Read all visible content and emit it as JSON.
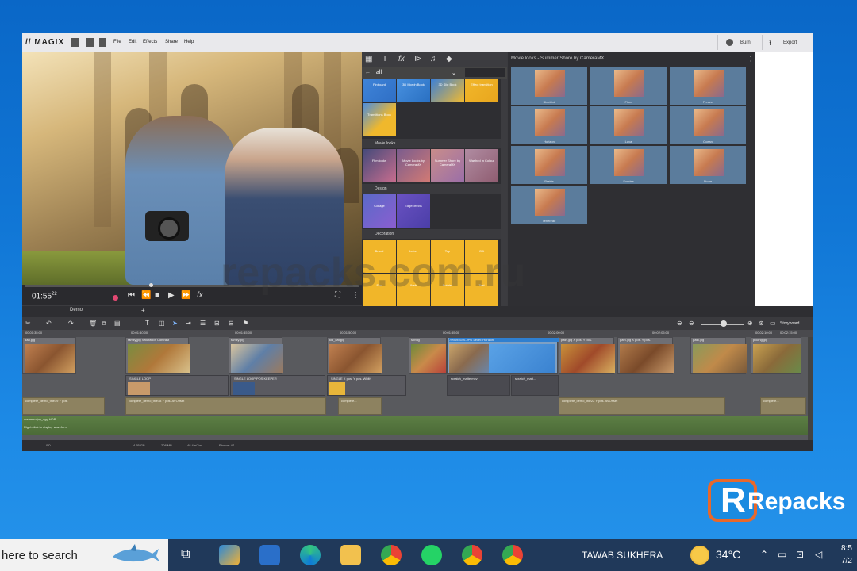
{
  "app": {
    "logo": "// MAGIX",
    "menu": [
      "File",
      "Edit",
      "Effects",
      "Share",
      "Help"
    ],
    "burn_label": "Burn",
    "export_label": "Export"
  },
  "preview": {
    "timecode": "01:55",
    "timecode_frames": "22",
    "fx_label": "fx"
  },
  "media_pool": {
    "filter_value": "all",
    "top_tiles": [
      "Pinboard",
      "3D Morph Book",
      "3D Slip Book",
      "Effect transition"
    ],
    "extra_tiles": [
      "Transitions Book"
    ],
    "sections": [
      {
        "name": "Movie looks",
        "tiles": [
          "Film looks",
          "Movie Looks by CameraMX",
          "Summer Shore by CameraMX",
          "Washed in Colour"
        ]
      },
      {
        "name": "Design",
        "tiles": [
          "Collage",
          "EdgeEffects"
        ]
      },
      {
        "name": "Decoration",
        "tiles": [
          "Brand",
          "Label",
          "Top",
          "Gift",
          "Fun",
          "Web",
          "Pointer",
          "Text"
        ]
      }
    ]
  },
  "looks_panel": {
    "title": "Movie looks - Summer Shore by CameraMX",
    "items": [
      "Bluebird",
      "Flora",
      "Freeze",
      "Horizon",
      "Lava",
      "Ocean",
      "Prairie",
      "Sunrise",
      "Stone",
      "Tenebrae"
    ]
  },
  "timeline": {
    "project_tab": "Demo",
    "storyboard_label": "Storyboard",
    "ruler": [
      "00:01:35:00",
      "00:01:40:00",
      "00:01:45:00",
      "00:01:50:00",
      "00:01:55:00",
      "00:02:00:00",
      "00:02:05:00",
      "00:02:10:00",
      "00:02:15:00"
    ],
    "video_clips": [
      "dad.jpg",
      "family.jpg  Saturation  Contrast",
      "family.jpg",
      "kid_cat.jpg",
      "spring",
      "70949464S.JPG  Level: Horizon",
      "path.jpg  X pos.  Y pos.",
      "path.jpg  X pos.  Y pos.",
      "path.jpg",
      "pocing.jpg"
    ],
    "overlay_clips": [
      "SINGLE LOOP",
      "SINGLE LOOP POS KEEPER",
      "SINGLE  X pos.  Y pos.  Width",
      "scratch_matte.mxv",
      "scratch_matt..."
    ],
    "title_clips": [
      "complete_demo_title19  Y pos.",
      "complete_demo_title18  Y pos.  AVOffset",
      "complete...",
      "complete_demo_title22  Y pos.  AVOffset",
      "complete..."
    ],
    "audio_clips": [
      "dreamsofjoy_ogg.HDP",
      "Right-click to display waveform"
    ],
    "status": [
      "0/0",
      "4.55 GB",
      "208 MB",
      "48.4m/7m",
      "Photos: 47"
    ]
  },
  "watermark": "repacks.com.ru",
  "brand_overlay": "Repacks",
  "taskbar": {
    "search_text": "here to search",
    "user": "TAWAB SUKHERA",
    "temperature": "34°C",
    "clock_time": "8:5",
    "clock_date": "7/2"
  }
}
